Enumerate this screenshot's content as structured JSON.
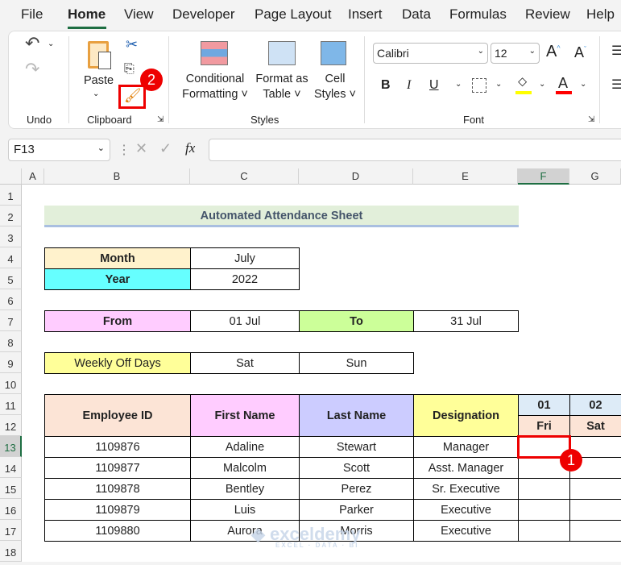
{
  "menu": {
    "tabs": [
      "File",
      "Home",
      "View",
      "Developer",
      "Page Layout",
      "Insert",
      "Data",
      "Formulas",
      "Review",
      "Help"
    ],
    "active": "Home"
  },
  "ribbon": {
    "undo_group": "Undo",
    "clipboard": {
      "paste": "Paste",
      "group": "Clipboard"
    },
    "styles": {
      "conditional": [
        "Conditional",
        "Formatting"
      ],
      "format_table": [
        "Format as",
        "Table"
      ],
      "cell_styles": [
        "Cell",
        "Styles"
      ],
      "group": "Styles"
    },
    "font": {
      "name": "Calibri",
      "size": "12",
      "group": "Font",
      "bold": "B",
      "italic": "I",
      "underline": "U",
      "highlight_color": "#ffff00",
      "font_color": "#ff0000"
    }
  },
  "formula_bar": {
    "name_box": "F13",
    "fx": "fx",
    "value": ""
  },
  "columns": [
    "A",
    "B",
    "C",
    "D",
    "E",
    "F",
    "G"
  ],
  "rows": [
    "1",
    "2",
    "3",
    "4",
    "5",
    "6",
    "7",
    "8",
    "9",
    "10",
    "11",
    "12",
    "13",
    "14",
    "15",
    "16",
    "17",
    "18"
  ],
  "selected_cell": "F13",
  "sheet": {
    "title": "Automated Attendance Sheet",
    "month_label": "Month",
    "month_value": "July",
    "year_label": "Year",
    "year_value": "2022",
    "from_label": "From",
    "from_value": "01 Jul",
    "to_label": "To",
    "to_value": "31 Jul",
    "weekly_off_label": "Weekly Off Days",
    "weekly_off_1": "Sat",
    "weekly_off_2": "Sun",
    "headers": {
      "id": "Employee ID",
      "first": "First Name",
      "last": "Last Name",
      "designation": "Designation"
    },
    "days": [
      {
        "date": "01",
        "day": "Fri"
      },
      {
        "date": "02",
        "day": "Sat"
      }
    ],
    "employees": [
      {
        "id": "1109876",
        "first": "Adaline",
        "last": "Stewart",
        "designation": "Manager"
      },
      {
        "id": "1109877",
        "first": "Malcolm",
        "last": "Scott",
        "designation": "Asst. Manager"
      },
      {
        "id": "1109878",
        "first": "Bentley",
        "last": "Perez",
        "designation": "Sr. Executive"
      },
      {
        "id": "1109879",
        "first": "Luis",
        "last": "Parker",
        "designation": "Executive"
      },
      {
        "id": "1109880",
        "first": "Aurora",
        "last": "Morris",
        "designation": "Executive"
      }
    ]
  },
  "annotations": {
    "step1": "1",
    "step2": "2"
  },
  "watermark": {
    "name": "exceldemy",
    "tagline": "EXCEL · DATA · BI"
  }
}
